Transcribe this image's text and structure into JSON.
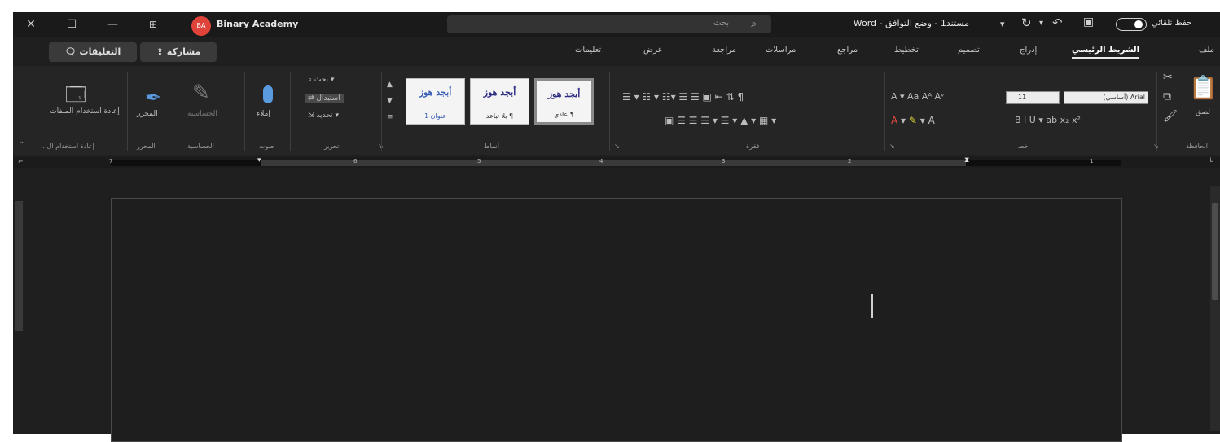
{
  "window": {
    "user": "Binary Academy",
    "avatar_initials": "BA",
    "search_placeholder": "بحث",
    "doc_title": "مستند1 - وضع التوافق - Word",
    "autosave_label": "حفظ تلقائي",
    "autosave_on": true
  },
  "tabs": [
    "ملف",
    "الشريط الرئيسي",
    "إدراج",
    "تصميم",
    "تخطيط",
    "مراجع",
    "مراسلات",
    "مراجعة",
    "عرض",
    "تعليمات"
  ],
  "active_tab": "الشريط الرئيسي",
  "actions": {
    "comments": "التعليقات",
    "share": "مشاركة"
  },
  "ribbon": {
    "groups": {
      "clipboard": "الحافظة",
      "font": "خط",
      "paragraph": "فقرة",
      "styles": "أنماط",
      "editing": "تحرير",
      "voice": "صوت",
      "sensitivity": "الحساسية",
      "editor": "المحرر",
      "reuse": "إعادة استخدام ال..."
    },
    "clipboard": {
      "paste": "لصق"
    },
    "font": {
      "name": "Arial (أساسي)",
      "size": "11"
    },
    "styles": [
      {
        "preview": "أبجد هوز",
        "name": "¶ عادي",
        "selected": true
      },
      {
        "preview": "أبجد هوز",
        "name": "¶ بلا تباعد",
        "selected": false
      },
      {
        "preview": "أبجد هوز",
        "name": "عنوان 1",
        "selected": false
      }
    ],
    "editing": {
      "find": "بحث",
      "replace": "استبدال",
      "select": "تحديد"
    },
    "voice": {
      "dictate": "إملاء"
    },
    "sensitivity": {
      "label": "الحساسية"
    },
    "editor": {
      "label": "المحرر"
    },
    "reuse": {
      "label": "إعادة استخدام الملفات"
    }
  },
  "ruler": {
    "numbers": [
      "1",
      "2",
      "3",
      "4",
      "5",
      "6",
      "7"
    ]
  }
}
